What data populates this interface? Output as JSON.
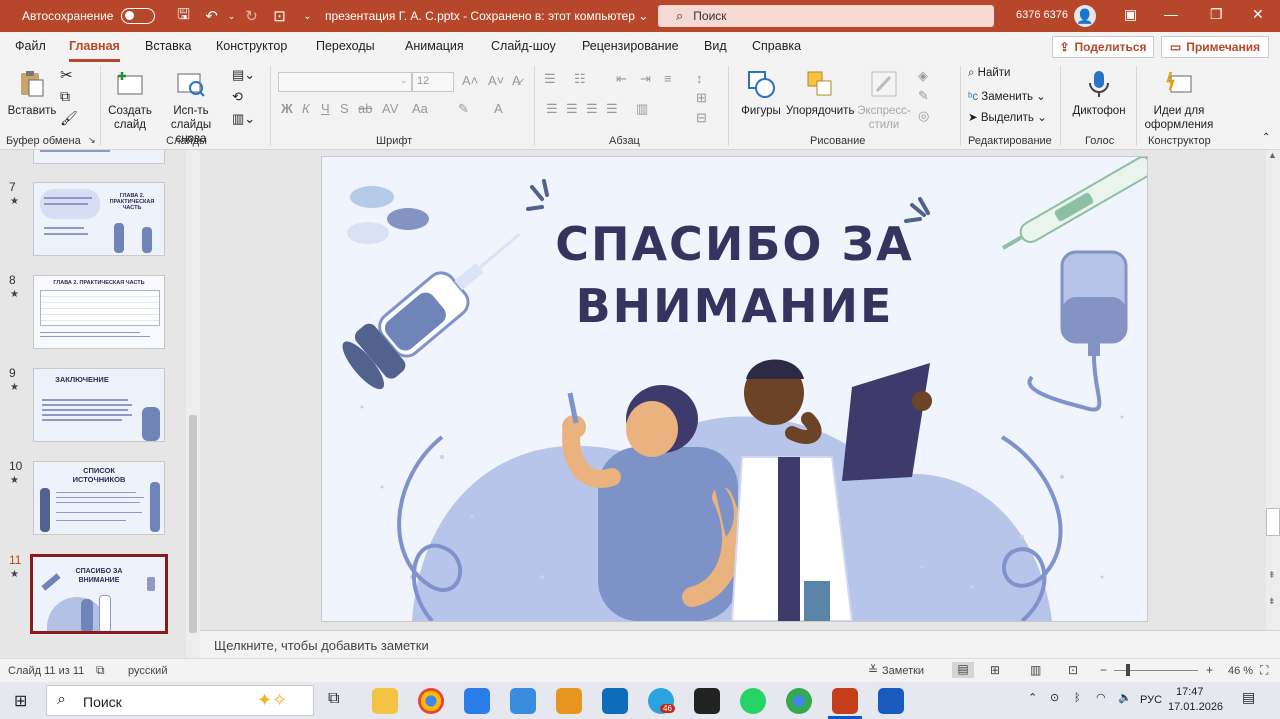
{
  "titlebar": {
    "autosave_label": "Автосохранение",
    "document_title": "презентация Г. А. С.pptx  -  Сохранено в: этот компьютер  ⌄",
    "search_placeholder": "Поиск",
    "user_name": "6376 6376"
  },
  "tabs": [
    "Файл",
    "Главная",
    "Вставка",
    "Конструктор",
    "Переходы",
    "Анимация",
    "Слайд-шоу",
    "Рецензирование",
    "Вид",
    "Справка"
  ],
  "share_label": "Поделиться",
  "comments_label": "Примечания",
  "ribbon": {
    "groups": [
      "Буфер обмена",
      "Слайды",
      "Шрифт",
      "Абзац",
      "Рисование",
      "Редактирование",
      "Голос",
      "Конструктор"
    ],
    "paste_label": "Вставить",
    "new_slide_label": "Создать слайд",
    "reuse_slides_label": "Исп-ть слайды снова",
    "font_size": "12",
    "shapes_label": "Фигуры",
    "arrange_label": "Упорядочить",
    "quick_styles_label": "Экспресс-стили",
    "find_label": "Найти",
    "replace_label": "Заменить",
    "select_label": "Выделить",
    "dictaphone_label": "Диктофон",
    "design_ideas_label": "Идеи для оформления"
  },
  "slides_panel": [
    {
      "number": "7",
      "title": "ГЛАВА 2. ПРАКТИЧЕСКАЯ ЧАСТЬ"
    },
    {
      "number": "8",
      "title": "ГЛАВА 2. ПРАКТИЧЕСКАЯ ЧАСТЬ"
    },
    {
      "number": "9",
      "title": "ЗАКЛЮЧЕНИЕ"
    },
    {
      "number": "10",
      "title": "СПИСОК ИСТОЧНИКОВ"
    },
    {
      "number": "11",
      "title": "СПАСИБО ЗА ВНИМАНИЕ"
    }
  ],
  "slide": {
    "title_line1": "СПАСИБО ЗА",
    "title_line2": "ВНИМАНИЕ"
  },
  "notes_placeholder": "Щелкните, чтобы добавить заметки",
  "status": {
    "slide_counter": "Слайд 11 из 11",
    "language": "русский",
    "notes_label": "Заметки",
    "zoom": "46 %"
  },
  "taskbar": {
    "search_label": "Поиск",
    "telegram_badge": "46",
    "input_language": "РУС",
    "time": "17:47",
    "date": "17.01.2026"
  },
  "colors": {
    "accent": "#b7472a",
    "slide_title": "#37335f",
    "slide_background": "#f0f4fc",
    "selected_thumb_border": "#8b1a1a"
  }
}
